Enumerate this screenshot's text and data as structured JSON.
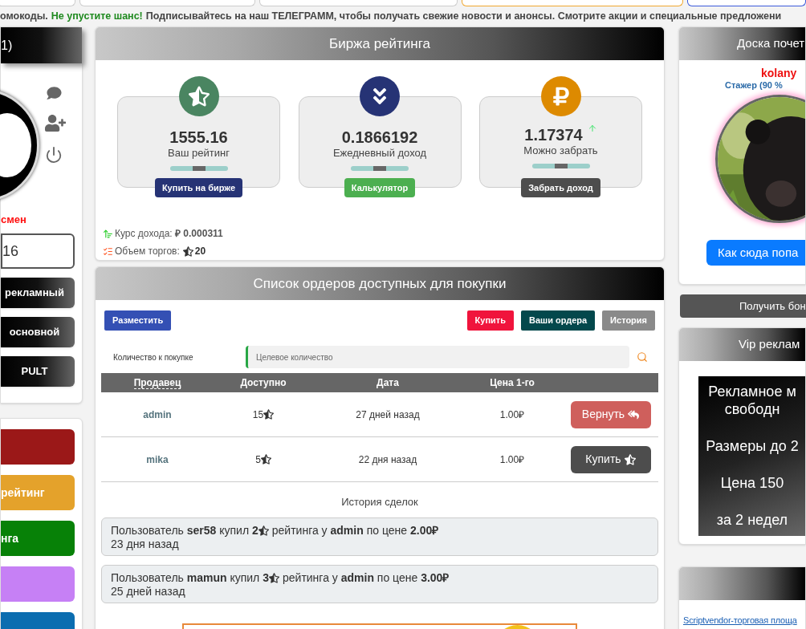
{
  "top_tabs": [
    {
      "color": "#cccccc"
    },
    {
      "color": "#cccccc"
    },
    {
      "color": "#cccccc"
    },
    {
      "color": "#f0a830"
    },
    {
      "color": "#3b5bdb"
    }
  ],
  "announcement": [
    {
      "text": "омокоды.",
      "highlight": false
    },
    {
      "text": "Не упустите шанс!",
      "highlight": true
    },
    {
      "text": "Подписывайтесь на наш ТЕЛЕГРАММ, чтобы получать свежие новости и анонсы. Смотрите акции и специальные предложени",
      "highlight": false
    }
  ],
  "profile": {
    "title": "1)",
    "status": "смен",
    "balance": "16",
    "buttons": [
      "рекламный",
      "основной",
      "PULT"
    ]
  },
  "menu": [
    {
      "color": "#9b1818"
    },
    {
      "label": "рейтинг",
      "color": "#e4a22b"
    },
    {
      "label": "нга",
      "color": "#078107"
    },
    {
      "color": "#c680f5"
    },
    {
      "color": "#0b6db0"
    }
  ],
  "exchange": {
    "title": "Биржа рейтинга",
    "cards": [
      {
        "kind": "rating",
        "value": "1555.16",
        "label": "Ваш рейтинг",
        "level": 0.5,
        "button": "Купить на бирже"
      },
      {
        "kind": "income",
        "value": "0.1866192",
        "label": "Ежедневный доход",
        "level": 0.5,
        "button": "Калькулятор"
      },
      {
        "kind": "withdraw",
        "value": "1.17374",
        "label": "Можно забрать",
        "level": 0.5,
        "button": "Забрать доход"
      }
    ],
    "rate": "Курс дохода: **₽ 0.000311**",
    "volume_label": "Объем торгов:",
    "volume": "20"
  },
  "orders": {
    "title": "Список ордеров доступных для покупки",
    "actions": [
      {
        "label": "Разместить",
        "kind": "place"
      },
      {
        "label": "Купить",
        "kind": "buy"
      },
      {
        "label": "Ваши ордера",
        "kind": "mine"
      },
      {
        "label": "История",
        "kind": "history"
      }
    ],
    "quantity": {
      "label": "Количество к покупке",
      "placeholder": "Целевое количество"
    },
    "columns": [
      "Продавец",
      "Доступно",
      "Дата",
      "Цена 1-го"
    ],
    "rows": [
      {
        "seller": "admin",
        "available": "15",
        "date": "27 дней назад",
        "price": "1.00₽",
        "action": {
          "label": "Вернуть",
          "kind": "return"
        }
      },
      {
        "seller": "mika",
        "available": "5",
        "date": "22 дня назад",
        "price": "1.00₽",
        "action": {
          "label": "Купить",
          "kind": "buy"
        }
      }
    ],
    "history_title": "История сделок",
    "history": [
      {
        "before": "Пользователь **ser58** купил **2**",
        "after": "рейтинга у **admin** по цене **2.00₽**",
        "time": "23 дня назад"
      },
      {
        "before": "Пользователь **mamun** купил **3**",
        "after": "рейтинга у **admin** по цене **3.00₽**",
        "time": "25 дней назад"
      }
    ]
  },
  "honor_board": {
    "title": "Доска почет",
    "user": "kolany",
    "rank": "Стажер (90 %",
    "button": "Как сюда попа"
  },
  "bonus_button": "Получить бон",
  "vip": {
    "title": "Vip реклам",
    "paragraphs": [
      [
        "Рекламное м",
        "свободн"
      ],
      [
        "Размеры до 2"
      ],
      [
        "Цена 150"
      ],
      [
        "за 2 недел"
      ]
    ]
  },
  "links_panel": {
    "link": "Scriptvendor-торговая площа"
  }
}
